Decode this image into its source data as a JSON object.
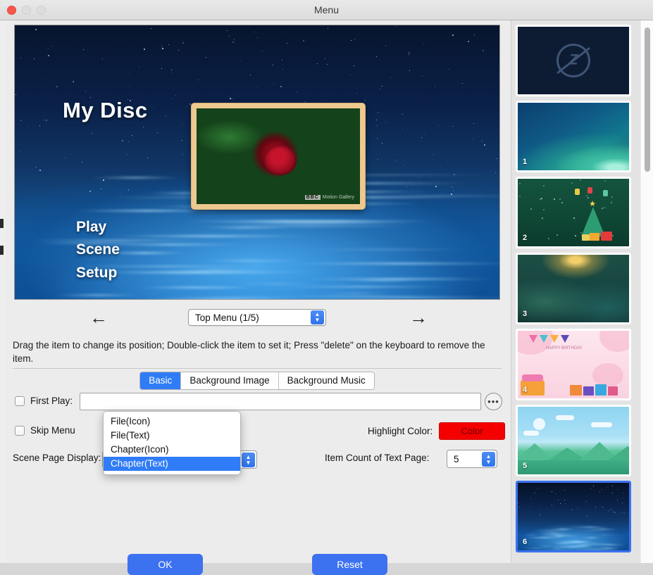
{
  "window": {
    "title": "Menu",
    "controls": {
      "close": "close",
      "minimize": "minimize",
      "maximize": "maximize"
    }
  },
  "preview": {
    "disc_title": "My Disc",
    "menu_items": [
      "Play",
      "Scene",
      "Setup"
    ],
    "thumbnail_watermark_brand": "BBC",
    "thumbnail_watermark_text": "Motion Gallery"
  },
  "nav": {
    "prev_arrow": "←",
    "next_arrow": "→",
    "page_selector_value": "Top Menu (1/5)",
    "stepper_up": "▲",
    "stepper_down": "▼"
  },
  "hint": "Drag the item to change its position; Double-click the item to set it; Press \"delete\" on the keyboard to remove the item.",
  "tabs": [
    {
      "label": "Basic",
      "active": true
    },
    {
      "label": "Background Image",
      "active": false
    },
    {
      "label": "Background Music",
      "active": false
    }
  ],
  "form": {
    "first_play_label": "First Play:",
    "first_play_value": "",
    "first_play_placeholder": "",
    "browse_button_label": "•••",
    "skip_menu_label": "Skip Menu",
    "scene_page_display_label": "Scene Page Display:",
    "scene_page_display_value": "Chapter(Text)",
    "highlight_color_label": "Highlight Color:",
    "highlight_color_button_label": "Color",
    "highlight_color_hex": "#f40000",
    "item_count_label": "Item Count of Text Page:",
    "item_count_value": "5"
  },
  "dropdown": {
    "open": true,
    "options": [
      "File(Icon)",
      "File(Text)",
      "Chapter(Icon)",
      "Chapter(Text)"
    ],
    "selected_index": 3
  },
  "footer": {
    "ok_label": "OK",
    "reset_label": "Reset"
  },
  "templates": {
    "selected_index": 6,
    "items": [
      {
        "number": "",
        "name": "no-menu"
      },
      {
        "number": "1",
        "name": "aurora"
      },
      {
        "number": "2",
        "name": "christmas"
      },
      {
        "number": "3",
        "name": "green-glow"
      },
      {
        "number": "4",
        "name": "birthday"
      },
      {
        "number": "5",
        "name": "landscape"
      },
      {
        "number": "6",
        "name": "ocean-night"
      }
    ]
  },
  "colors": {
    "accent": "#3c72f0",
    "tab_active": "#2f7cf6",
    "highlight": "#f40000",
    "window_bg": "#ececec"
  }
}
